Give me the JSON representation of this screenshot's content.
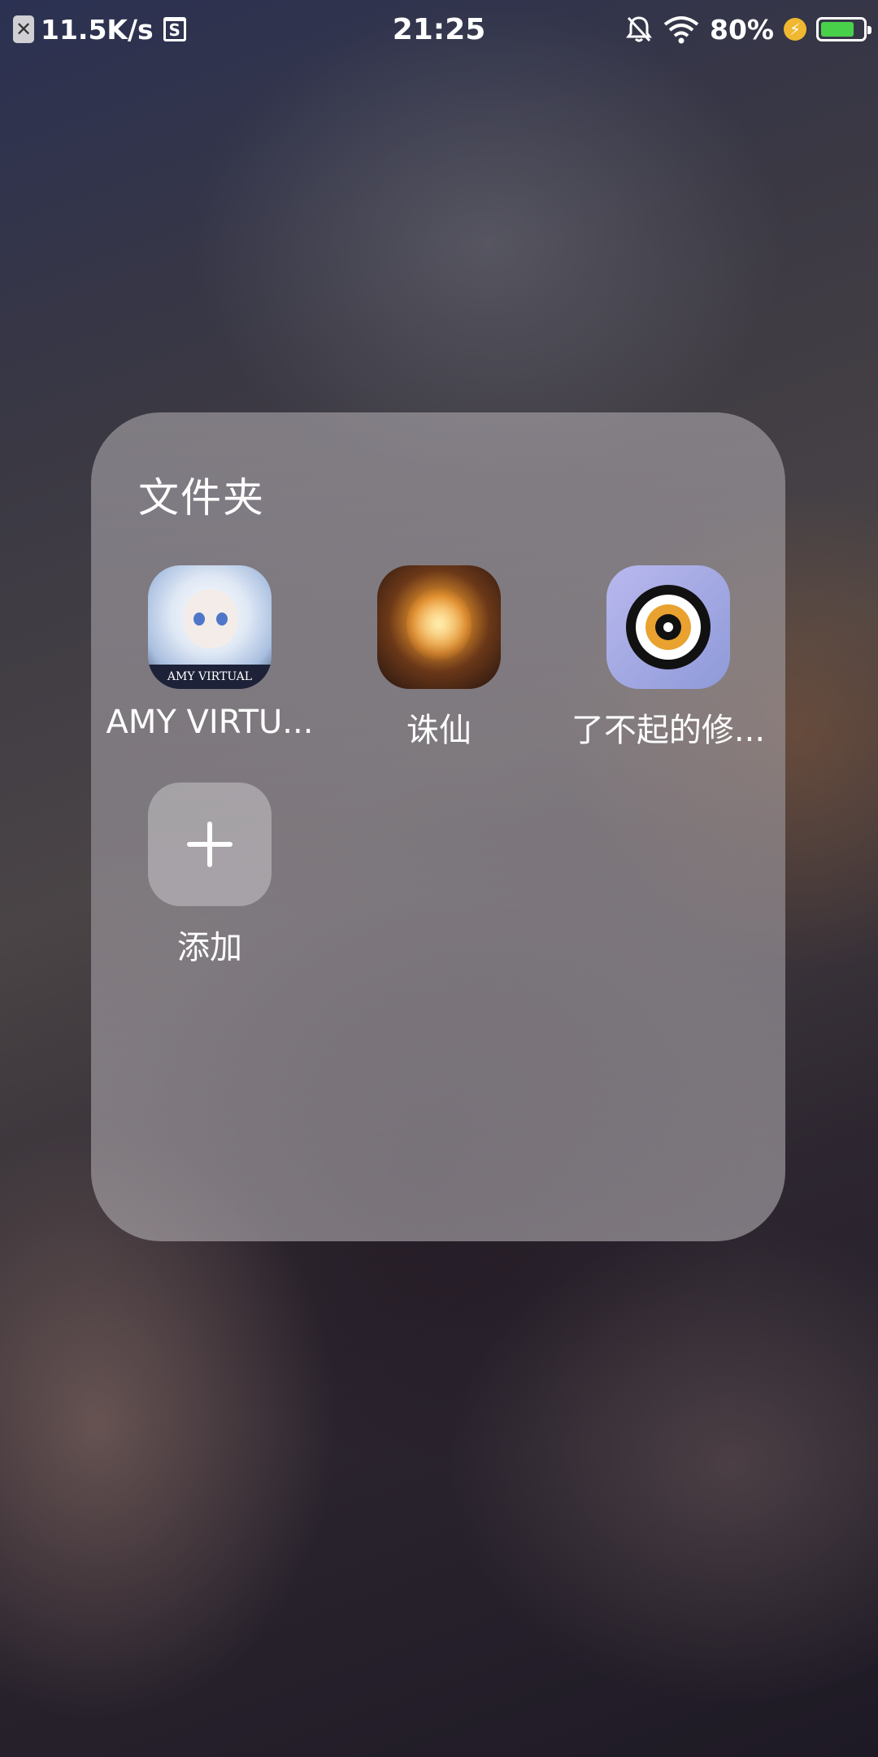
{
  "status_bar": {
    "net_speed": "11.5K/s",
    "time": "21:25",
    "battery_percent": "80%",
    "battery_level": 0.8,
    "battery_color": "#49d04a",
    "icons": [
      "close-notification-icon",
      "sim-s-icon",
      "mute-bell-icon",
      "wifi-icon",
      "charging-bolt-icon",
      "battery-icon"
    ]
  },
  "folder": {
    "title": "文件夹",
    "apps": [
      {
        "label": "AMY VIRTU...",
        "icon_text": "AMY VIRTUAL"
      },
      {
        "label": "诛仙"
      },
      {
        "label": "了不起的修..."
      }
    ],
    "add": {
      "label": "添加"
    }
  }
}
